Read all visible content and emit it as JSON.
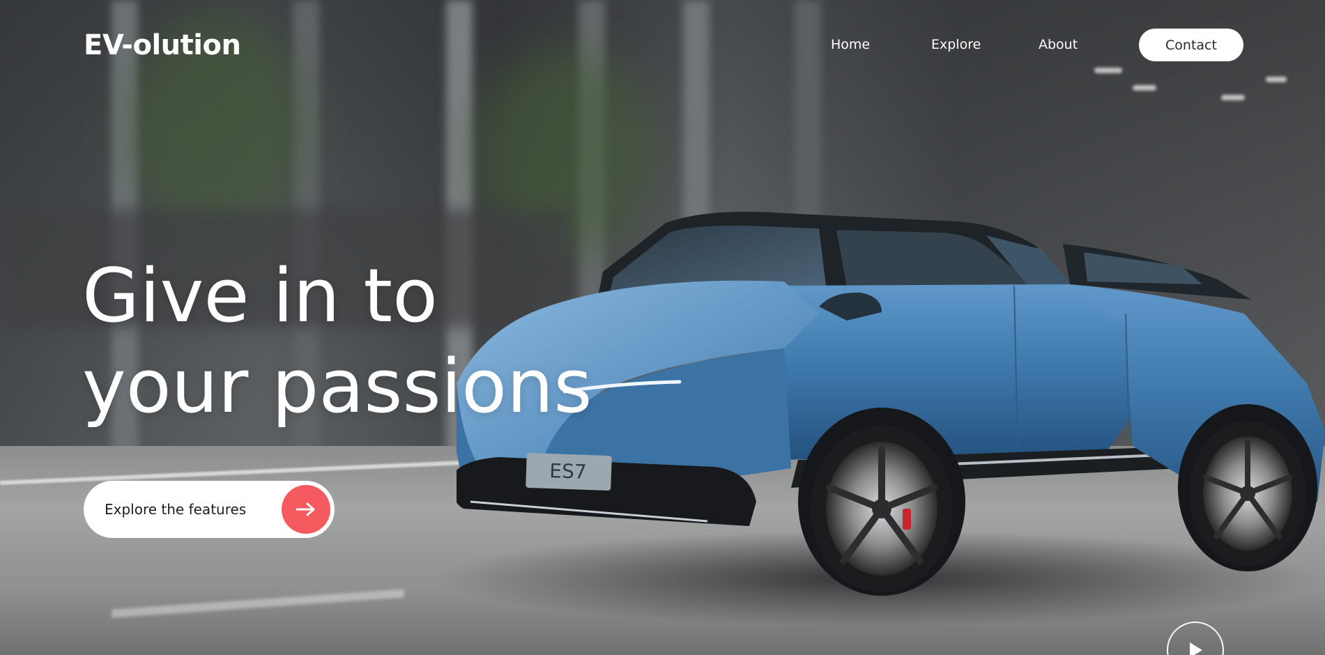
{
  "brand": {
    "logo_text": "EV-olution"
  },
  "nav": {
    "items": [
      {
        "label": "Home"
      },
      {
        "label": "Explore"
      },
      {
        "label": "About"
      }
    ],
    "contact_label": "Contact"
  },
  "hero": {
    "headline_line1": "Give in to",
    "headline_line2": "your passions",
    "cta_label": "Explore the features",
    "cta_icon": "arrow-right-icon",
    "play_icon": "play-icon",
    "image_description": "blue electric SUV driving on a street",
    "plate_text": "ES7"
  },
  "colors": {
    "accent": "#f55a5e",
    "text_on_dark": "#ffffff",
    "button_bg": "#ffffff",
    "car_body": "#3e78ab"
  }
}
